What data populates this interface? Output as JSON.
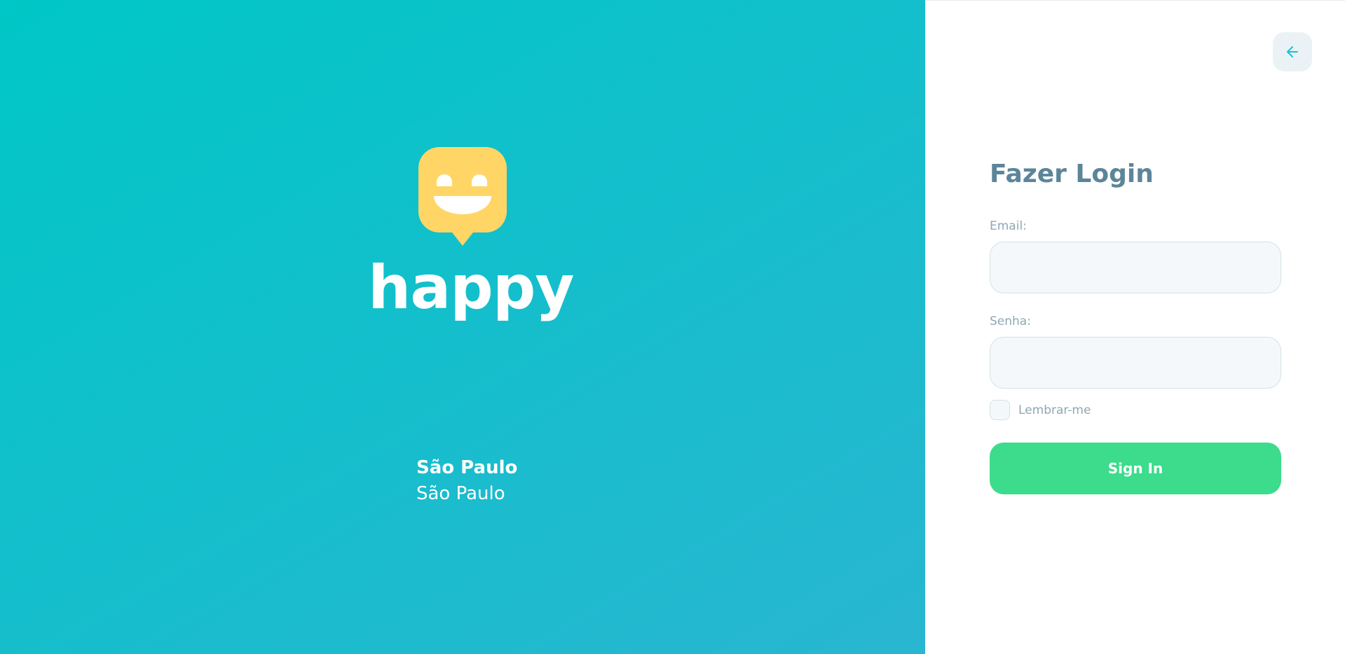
{
  "brand": {
    "name": "happy",
    "logo_icon": "smiling-chat-bubble-icon",
    "logo_color": "#FFD666",
    "gradient_from": "#00C7C7",
    "gradient_to": "#29B6D1"
  },
  "location": {
    "city": "São Paulo",
    "state": "São Paulo"
  },
  "navigation": {
    "back_icon": "arrow-left-icon",
    "accent": "#15C3D6"
  },
  "login": {
    "title": "Fazer Login",
    "email_label": "Email:",
    "email_value": "",
    "password_label": "Senha:",
    "password_value": "",
    "remember_label": "Lembrar-me",
    "remember_checked": false,
    "submit_label": "Sign In",
    "submit_color": "#3CDC8C"
  }
}
